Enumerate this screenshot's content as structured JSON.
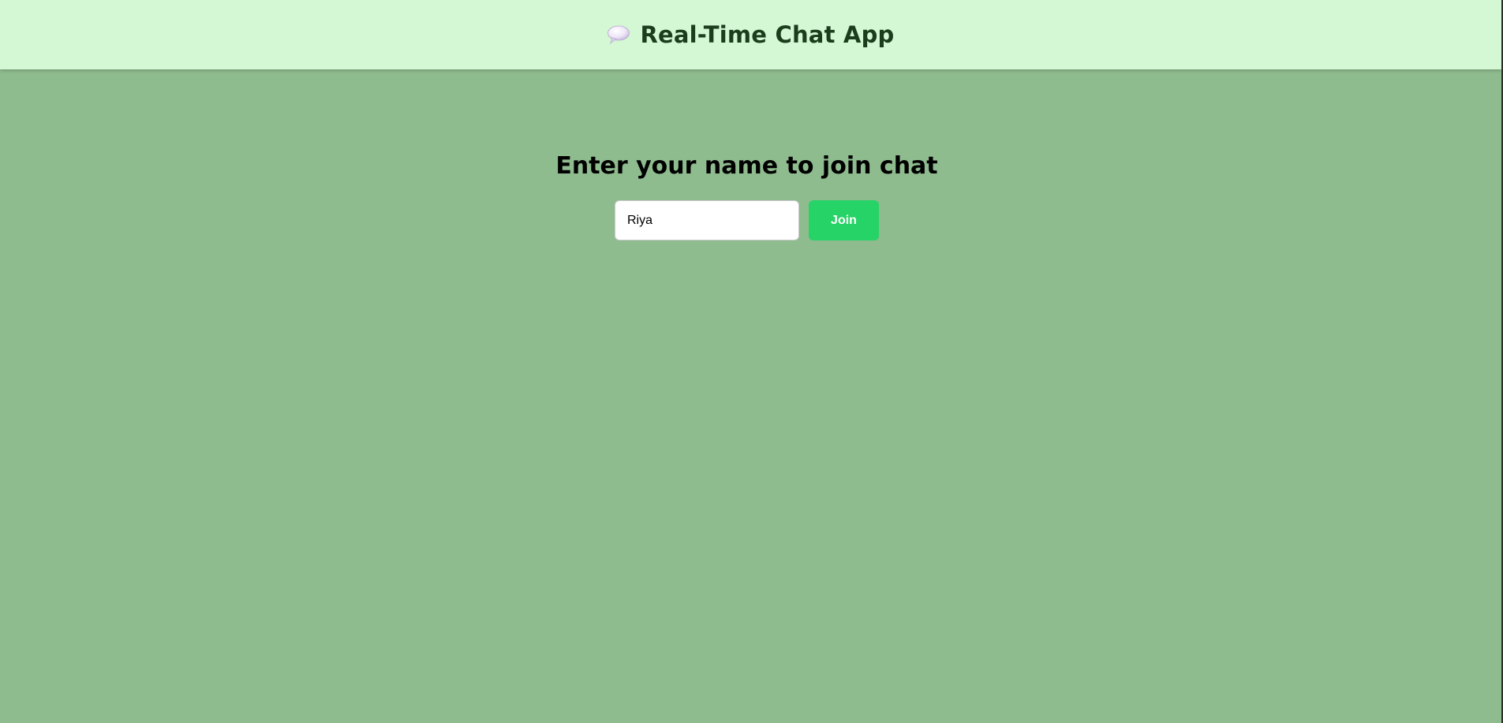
{
  "header": {
    "icon": "speech-bubble-icon",
    "title": "Real-Time Chat App"
  },
  "join": {
    "heading": "Enter your name to join chat",
    "name_value": "Riya",
    "button_label": "Join"
  },
  "colors": {
    "page_background": "#8fbc8f",
    "header_background": "#d4f7d4",
    "title_text": "#1c3d1c",
    "join_button": "#25d366"
  }
}
